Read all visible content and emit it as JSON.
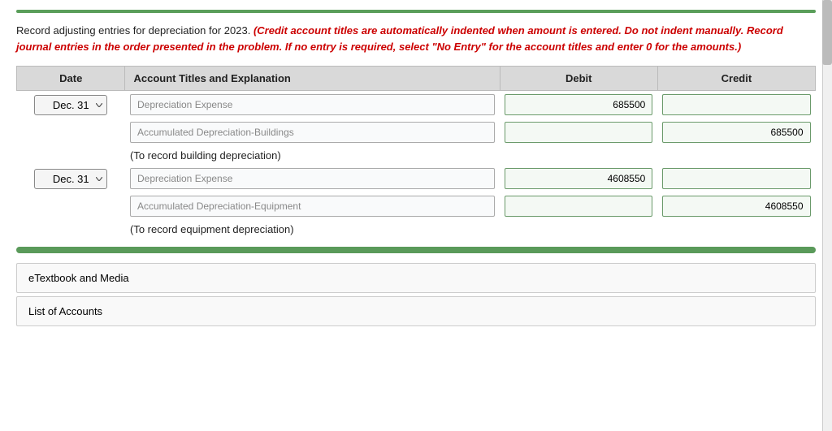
{
  "page": {
    "top_bar_color": "#5a9e5a",
    "instructions": {
      "main": "Record adjusting entries for depreciation for 2023.",
      "italic_red": "(Credit account titles are automatically indented when amount is entered. Do not indent manually. Record journal entries in the order presented in the problem. If no entry is required, select \"No Entry\" for the account titles and enter 0 for the amounts.)"
    },
    "table": {
      "headers": [
        "Date",
        "Account Titles and Explanation",
        "Debit",
        "Credit"
      ],
      "entry1": {
        "date": "Dec. 31",
        "row1": {
          "account": "Depreciation Expense",
          "debit": "685500",
          "credit": ""
        },
        "row2": {
          "account": "Accumulated Depreciation-Buildings",
          "debit": "",
          "credit": "685500"
        },
        "note": "(To record building depreciation)"
      },
      "entry2": {
        "date": "Dec. 31",
        "row1": {
          "account": "Depreciation Expense",
          "debit": "4608550",
          "credit": ""
        },
        "row2": {
          "account": "Accumulated Depreciation-Equipment",
          "debit": "",
          "credit": "4608550"
        },
        "note": "(To record equipment depreciation)"
      }
    },
    "bottom_buttons": {
      "etextbook": "eTextbook and Media",
      "list_of_accounts": "List of Accounts"
    }
  }
}
